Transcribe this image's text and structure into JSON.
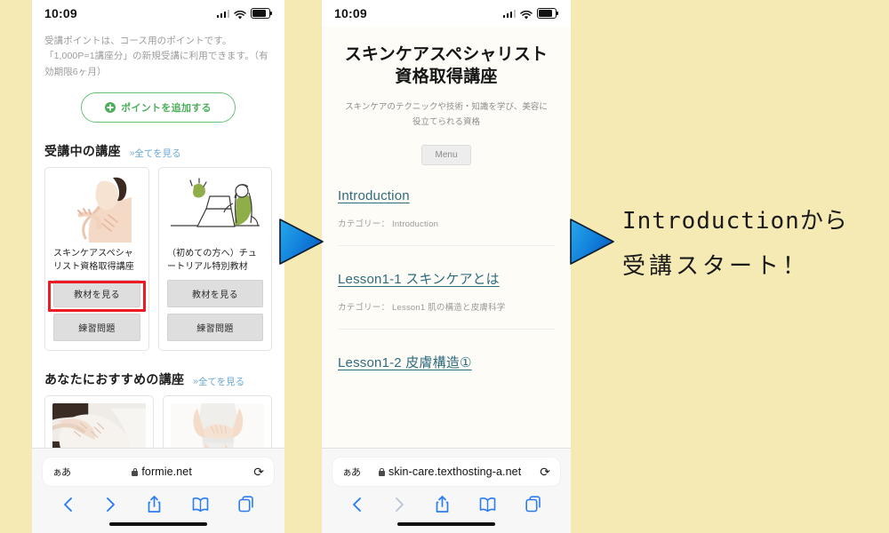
{
  "background_color": "#f5e9b4",
  "left_phone": {
    "status_bar": {
      "time": "10:09",
      "signal_icon": "cellular-signal-icon",
      "wifi_icon": "wifi-icon",
      "battery_icon": "battery-icon"
    },
    "points_note": "受講ポイントは、コース用のポイントです。「1,000P=1講座分」の新規受講に利用できます。（有効期限6ヶ月）",
    "add_points_button": "ポイントを追加する",
    "enrolled_section": {
      "title": "受講中の講座",
      "see_all": "全てを見る"
    },
    "enrolled_cards": [
      {
        "title": "スキンケアスペシャリスト資格取得講座",
        "image": "woman-skincare-photo",
        "primary_button": "教材を見る",
        "secondary_button": "練習問題",
        "highlighted": true
      },
      {
        "title": "（初めての方へ）チュートリアル特別教材",
        "image": "person-at-laptop-illustration",
        "primary_button": "教材を見る",
        "secondary_button": "練習問題",
        "highlighted": false
      }
    ],
    "recommended_section": {
      "title": "あなたにおすすめの講座",
      "see_all": "全てを見る"
    },
    "recommended_cards": [
      {
        "image": "massage-photo"
      },
      {
        "image": "waist-hands-photo"
      }
    ],
    "browser": {
      "text_size_label": "ぁあ",
      "lock_icon": "lock-icon",
      "url": "formie.net",
      "reload_icon": "reload-icon",
      "nav": {
        "back_icon": "chevron-left-icon",
        "forward_icon": "chevron-right-icon",
        "share_icon": "share-icon",
        "bookmarks_icon": "book-icon",
        "tabs_icon": "tabs-icon"
      }
    }
  },
  "middle_phone": {
    "status_bar": {
      "time": "10:09",
      "signal_icon": "cellular-signal-icon",
      "wifi_icon": "wifi-icon",
      "battery_icon": "battery-icon"
    },
    "page_title": "スキンケアスペシャリスト資格取得講座",
    "page_subtitle": "スキンケアのテクニックや技術・知識を学び、美容に役立てられる資格",
    "menu_button": "Menu",
    "lessons": [
      {
        "link": "Introduction",
        "category_label": "カテゴリー：",
        "category": "Introduction"
      },
      {
        "link": "Lesson1-1 スキンケアとは",
        "category_label": "カテゴリー：",
        "category": "Lesson1 肌の構造と皮膚科学"
      },
      {
        "link": "Lesson1-2 皮膚構造①",
        "category_label": "",
        "category": ""
      }
    ],
    "browser": {
      "text_size_label": "ぁあ",
      "lock_icon": "lock-icon",
      "url": "skin-care.texthosting-a.net",
      "reload_icon": "reload-icon",
      "nav": {
        "back_icon": "chevron-left-icon",
        "forward_icon": "chevron-right-icon",
        "share_icon": "share-icon",
        "bookmarks_icon": "book-icon",
        "tabs_icon": "tabs-icon"
      }
    }
  },
  "arrows": {
    "first": "blue-triangle-arrow-right",
    "second": "blue-triangle-arrow-right",
    "color": "#1a8fe0"
  },
  "annotation": {
    "line1": "Introductionから",
    "line2": "受講スタート！"
  }
}
